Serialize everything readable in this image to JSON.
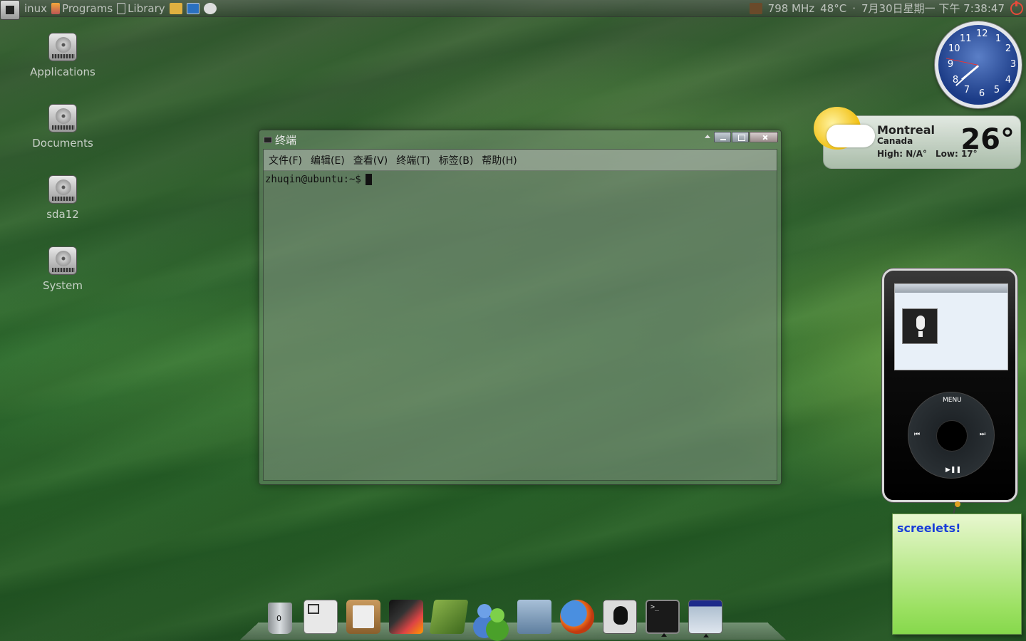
{
  "top_panel": {
    "left_items": [
      "inux",
      "Programs",
      "Library"
    ],
    "cpu_freq": "798 MHz",
    "temp": "48°C",
    "datetime": "7月30日星期一 下午 7:38:47"
  },
  "desktop_icons": [
    {
      "label": "Applications"
    },
    {
      "label": "Documents"
    },
    {
      "label": "sda12"
    },
    {
      "label": "System"
    }
  ],
  "terminal": {
    "title": "终端",
    "menu": [
      "文件(F)",
      "编辑(E)",
      "查看(V)",
      "终端(T)",
      "标签(B)",
      "帮助(H)"
    ],
    "prompt": "zhuqin@ubuntu:~$"
  },
  "clock": {
    "numbers": [
      "12",
      "1",
      "2",
      "3",
      "4",
      "5",
      "6",
      "7",
      "8",
      "9",
      "10",
      "11"
    ],
    "time": "7:38:47"
  },
  "weather": {
    "city": "Montreal",
    "country": "Canada",
    "high": "High: N/A°",
    "low": "Low: 17°",
    "temp": "26°"
  },
  "ipod": {
    "menu": "MENU",
    "prev": "⏮",
    "next": "⏭",
    "play": "▶❚❚"
  },
  "note": {
    "text": "screelets!"
  },
  "dock": {
    "trash_count": "0",
    "items": [
      "trash",
      "window",
      "clipboard",
      "matlab",
      "book",
      "buddies",
      "folder",
      "firefox",
      "qq",
      "terminal",
      "desktop"
    ]
  },
  "colors": {
    "note_text": "#1a3ed8",
    "power": "#e64a3a"
  }
}
